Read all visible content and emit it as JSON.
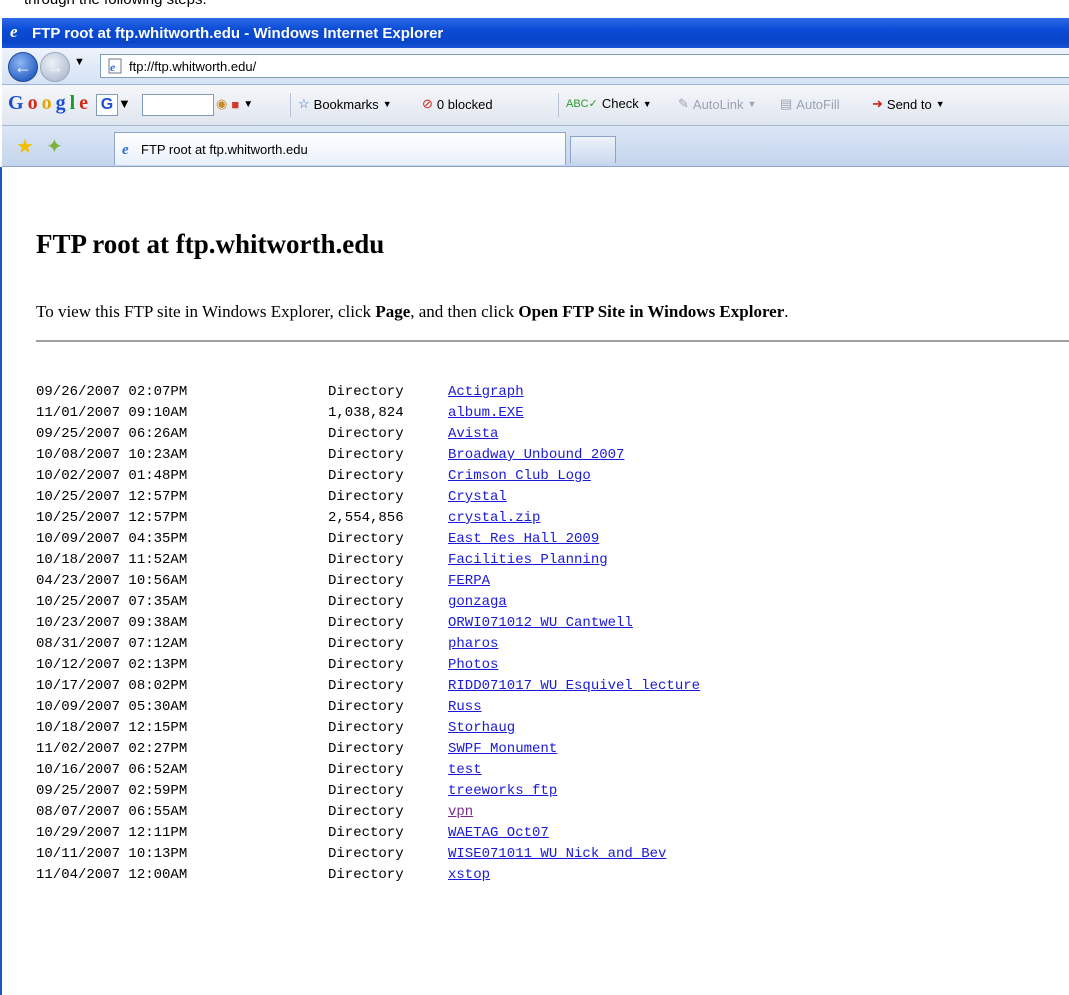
{
  "caption_partial": "through the following steps.",
  "window": {
    "title": "FTP root at ftp.whitworth.edu - Windows Internet Explorer"
  },
  "address_bar": {
    "url": "ftp://ftp.whitworth.edu/"
  },
  "google_toolbar": {
    "logo": "Google",
    "search_engine_letter": "G",
    "bookmarks_label": "Bookmarks",
    "popup_blocked_label": "0 blocked",
    "spellcheck_label": "Check",
    "autolink_label": "AutoLink",
    "autofill_label": "AutoFill",
    "sendto_label": "Send to"
  },
  "tab": {
    "label": "FTP root at ftp.whitworth.edu"
  },
  "page": {
    "heading": "FTP root at ftp.whitworth.edu",
    "intro_pre": "To view this FTP site in Windows Explorer, click ",
    "intro_page": "Page",
    "intro_mid": ", and then click ",
    "intro_open": "Open FTP Site in Windows Explorer",
    "intro_end": "."
  },
  "listing": [
    {
      "date": "09/26/2007 02:07PM",
      "size": "Directory",
      "name": "Actigraph"
    },
    {
      "date": "11/01/2007 09:10AM",
      "size": "1,038,824",
      "name": "album.EXE"
    },
    {
      "date": "09/25/2007 06:26AM",
      "size": "Directory",
      "name": "Avista"
    },
    {
      "date": "10/08/2007 10:23AM",
      "size": "Directory",
      "name": "Broadway Unbound 2007"
    },
    {
      "date": "10/02/2007 01:48PM",
      "size": "Directory",
      "name": "Crimson Club Logo"
    },
    {
      "date": "10/25/2007 12:57PM",
      "size": "Directory",
      "name": "Crystal"
    },
    {
      "date": "10/25/2007 12:57PM",
      "size": "2,554,856",
      "name": "crystal.zip"
    },
    {
      "date": "10/09/2007 04:35PM",
      "size": "Directory",
      "name": "East Res Hall 2009"
    },
    {
      "date": "10/18/2007 11:52AM",
      "size": "Directory",
      "name": "Facilities Planning"
    },
    {
      "date": "04/23/2007 10:56AM",
      "size": "Directory",
      "name": "FERPA"
    },
    {
      "date": "10/25/2007 07:35AM",
      "size": "Directory",
      "name": "gonzaga"
    },
    {
      "date": "10/23/2007 09:38AM",
      "size": "Directory",
      "name": "ORWI071012 WU Cantwell"
    },
    {
      "date": "08/31/2007 07:12AM",
      "size": "Directory",
      "name": "pharos"
    },
    {
      "date": "10/12/2007 02:13PM",
      "size": "Directory",
      "name": "Photos"
    },
    {
      "date": "10/17/2007 08:02PM",
      "size": "Directory",
      "name": "RIDD071017 WU Esquivel lecture"
    },
    {
      "date": "10/09/2007 05:30AM",
      "size": "Directory",
      "name": "Russ"
    },
    {
      "date": "10/18/2007 12:15PM",
      "size": "Directory",
      "name": "Storhaug"
    },
    {
      "date": "11/02/2007 02:27PM",
      "size": "Directory",
      "name": "SWPF Monument"
    },
    {
      "date": "10/16/2007 06:52AM",
      "size": "Directory",
      "name": "test"
    },
    {
      "date": "09/25/2007 02:59PM",
      "size": "Directory",
      "name": "treeworks ftp"
    },
    {
      "date": "08/07/2007 06:55AM",
      "size": "Directory",
      "name": "vpn",
      "visited": true
    },
    {
      "date": "10/29/2007 12:11PM",
      "size": "Directory",
      "name": "WAETAG Oct07"
    },
    {
      "date": "10/11/2007 10:13PM",
      "size": "Directory",
      "name": "WISE071011 WU Nick and Bev"
    },
    {
      "date": "11/04/2007 12:00AM",
      "size": "Directory",
      "name": "xstop"
    }
  ],
  "colors": {
    "link": "#1a1ad8",
    "visited_link": "#7b2a8c",
    "titlebar": "#0a4bd6"
  }
}
